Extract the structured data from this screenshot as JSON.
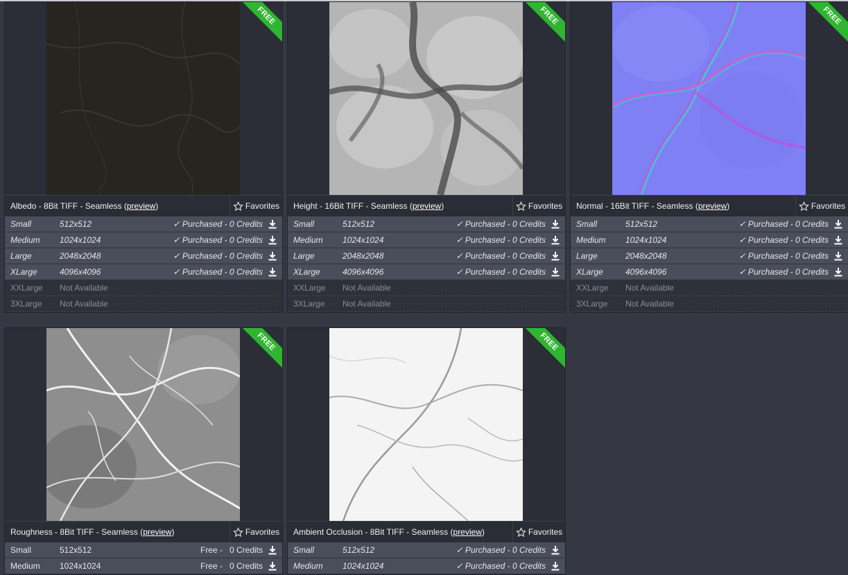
{
  "ribbon_label": "FREE",
  "favorites_label": "Favorites",
  "preview_label": "preview",
  "cards": [
    {
      "title_prefix": "Albedo - 8Bit TIFF - Seamless (",
      "rows": [
        {
          "size": "Small",
          "res": "512x512",
          "status": "✓ Purchased - 0 Credits"
        },
        {
          "size": "Medium",
          "res": "1024x1024",
          "status": "✓ Purchased - 0 Credits"
        },
        {
          "size": "Large",
          "res": "2048x2048",
          "status": "✓ Purchased - 0 Credits"
        },
        {
          "size": "XLarge",
          "res": "4096x4096",
          "status": "✓ Purchased - 0 Credits"
        },
        {
          "size": "XXLarge",
          "res": "Not Available"
        },
        {
          "size": "3XLarge",
          "res": "Not Available"
        }
      ]
    },
    {
      "title_prefix": "Height - 16Bit TIFF - Seamless (",
      "rows": [
        {
          "size": "Small",
          "res": "512x512",
          "status": "✓ Purchased - 0 Credits"
        },
        {
          "size": "Medium",
          "res": "1024x1024",
          "status": "✓ Purchased - 0 Credits"
        },
        {
          "size": "Large",
          "res": "2048x2048",
          "status": "✓ Purchased - 0 Credits"
        },
        {
          "size": "XLarge",
          "res": "4096x4096",
          "status": "✓ Purchased - 0 Credits"
        },
        {
          "size": "XXLarge",
          "res": "Not Available"
        },
        {
          "size": "3XLarge",
          "res": "Not Available"
        }
      ]
    },
    {
      "title_prefix": "Normal - 16Bit TIFF - Seamless (",
      "rows": [
        {
          "size": "Small",
          "res": "512x512",
          "status": "✓ Purchased - 0 Credits"
        },
        {
          "size": "Medium",
          "res": "1024x1024",
          "status": "✓ Purchased - 0 Credits"
        },
        {
          "size": "Large",
          "res": "2048x2048",
          "status": "✓ Purchased - 0 Credits"
        },
        {
          "size": "XLarge",
          "res": "4096x4096",
          "status": "✓ Purchased - 0 Credits"
        },
        {
          "size": "XXLarge",
          "res": "Not Available"
        },
        {
          "size": "3XLarge",
          "res": "Not Available"
        }
      ]
    },
    {
      "title_prefix": "Roughness - 8Bit TIFF - Seamless (",
      "rows": [
        {
          "size": "Small",
          "res": "512x512",
          "free": "Free -",
          "status": "0 Credits"
        },
        {
          "size": "Medium",
          "res": "1024x1024",
          "free": "Free -",
          "status": "0 Credits"
        }
      ]
    },
    {
      "title_prefix": "Ambient Occlusion - 8Bit TIFF - Seamless (",
      "rows": [
        {
          "size": "Small",
          "res": "512x512",
          "status": "✓ Purchased - 0 Credits"
        },
        {
          "size": "Medium",
          "res": "1024x1024",
          "status": "✓ Purchased - 0 Credits"
        }
      ]
    }
  ],
  "colors": {
    "ribbon": "#2fb52f",
    "available_row": "#4a4e5b",
    "background": "#353842"
  }
}
